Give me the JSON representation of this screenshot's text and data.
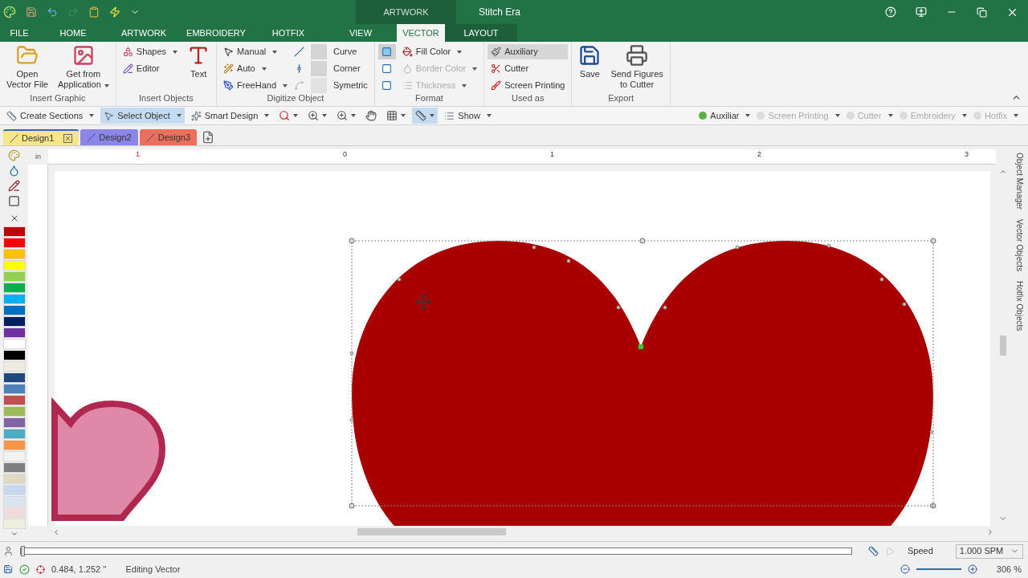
{
  "window": {
    "context_tab": "ARTWORK",
    "title": "Stitch Era"
  },
  "menu_tabs": [
    {
      "label": "FILE",
      "selected": false
    },
    {
      "label": "HOME",
      "selected": false
    },
    {
      "label": "ARTWORK",
      "selected": false
    },
    {
      "label": "EMBROIDERY",
      "selected": false
    },
    {
      "label": "HOTFIX",
      "selected": false
    },
    {
      "label": "VIEW",
      "selected": false
    },
    {
      "label": "VECTOR",
      "selected": true
    },
    {
      "label": "LAYOUT",
      "selected": false
    }
  ],
  "ribbon": [
    {
      "label": "Insert Graphic",
      "items": [
        {
          "kind": "large",
          "lines": [
            "Open",
            "Vector File"
          ],
          "dropdown": false,
          "disabled": false
        },
        {
          "kind": "large",
          "lines": [
            "Get from",
            "Application"
          ],
          "dropdown": true,
          "disabled": false
        }
      ]
    },
    {
      "label": "Insert Objects",
      "items": [
        {
          "kind": "small",
          "label": "Shapes",
          "dropdown": true,
          "disabled": false
        },
        {
          "kind": "small",
          "label": "Editor",
          "dropdown": false,
          "disabled": false
        },
        {
          "kind": "large",
          "lines": [
            "Text"
          ],
          "dropdown": false,
          "disabled": false
        }
      ]
    },
    {
      "label": "Digitize Object",
      "items": [
        {
          "kind": "small",
          "label": "Manual",
          "dropdown": true,
          "disabled": false
        },
        {
          "kind": "small",
          "label": "Auto",
          "dropdown": true,
          "disabled": false
        },
        {
          "kind": "small",
          "label": "FreeHand",
          "dropdown": true,
          "disabled": false
        },
        {
          "kind": "tool",
          "label": "Curve",
          "disabled": false
        },
        {
          "kind": "tool",
          "label": "Corner",
          "disabled": false
        },
        {
          "kind": "tool",
          "label": "Symetric",
          "disabled": true
        }
      ]
    },
    {
      "label": "Format",
      "items": [
        {
          "kind": "swatch",
          "selected": true
        },
        {
          "kind": "swatch",
          "selected": false
        },
        {
          "kind": "swatch",
          "selected": false
        },
        {
          "kind": "small",
          "label": "Fill Color",
          "dropdown": true,
          "disabled": false
        },
        {
          "kind": "small",
          "label": "Border Color",
          "dropdown": true,
          "disabled": true
        },
        {
          "kind": "small",
          "label": "Thickness",
          "dropdown": true,
          "disabled": true
        }
      ]
    },
    {
      "label": "Used as",
      "items": [
        {
          "kind": "small",
          "label": "Auxiliary",
          "dropdown": false,
          "disabled": false,
          "selected": true
        },
        {
          "kind": "small",
          "label": "Cutter",
          "dropdown": false,
          "disabled": false,
          "selected": false
        },
        {
          "kind": "small",
          "label": "Screen Printing",
          "dropdown": false,
          "disabled": false,
          "selected": false
        }
      ]
    },
    {
      "label": "Export",
      "items": [
        {
          "kind": "large",
          "lines": [
            "Save"
          ],
          "dropdown": false,
          "disabled": false
        },
        {
          "kind": "large",
          "lines": [
            "Send Figures",
            "to Cutter"
          ],
          "dropdown": false,
          "disabled": false
        }
      ]
    }
  ],
  "toolbar": [
    {
      "kind": "button",
      "label": "Create Sections",
      "selected": false
    },
    {
      "kind": "button",
      "label": "Select Object",
      "selected": true
    },
    {
      "kind": "button",
      "label": "Smart Design",
      "selected": false
    },
    {
      "kind": "icon",
      "dropdown": true,
      "selected": false
    },
    {
      "kind": "icon",
      "dropdown": true,
      "selected": false
    },
    {
      "kind": "icon",
      "dropdown": true,
      "selected": false
    },
    {
      "kind": "icon",
      "dropdown": false,
      "selected": false
    },
    {
      "kind": "icon",
      "dropdown": true,
      "selected": false
    },
    {
      "kind": "icon",
      "dropdown": true,
      "selected": true
    },
    {
      "kind": "button",
      "label": "Show",
      "selected": false
    }
  ],
  "layers": [
    {
      "label": "Auxiliar",
      "on": true
    },
    {
      "label": "Screen Printing",
      "on": false
    },
    {
      "label": "Cutter",
      "on": false
    },
    {
      "label": "Embroidery",
      "on": false
    },
    {
      "label": "Hotfix",
      "on": false
    }
  ],
  "documents": [
    {
      "label": "Design1",
      "selected": true,
      "color": "#f7e58a"
    },
    {
      "label": "Design2",
      "selected": false,
      "color": "#8c86e8"
    },
    {
      "label": "Design3",
      "selected": false,
      "color": "#e8705c"
    }
  ],
  "ruler": {
    "unit": "in",
    "marks": [
      {
        "label": "1",
        "negative": true
      },
      {
        "label": "0",
        "negative": false
      },
      {
        "label": "1",
        "negative": false
      },
      {
        "label": "2",
        "negative": false
      },
      {
        "label": "3",
        "negative": false
      }
    ]
  },
  "palette": [
    {
      "color": "#c00000"
    },
    {
      "color": "#ff0000"
    },
    {
      "color": "#ffc000"
    },
    {
      "color": "#ffff00"
    },
    {
      "color": "#92d050"
    },
    {
      "color": "#00b050"
    },
    {
      "color": "#00b0f0"
    },
    {
      "color": "#0070c0"
    },
    {
      "color": "#002060"
    },
    {
      "color": "#7030a0"
    },
    {
      "color": "#ffffff"
    },
    {
      "color": "#000000"
    },
    {
      "color": "#eeece1"
    },
    {
      "color": "#1f497d"
    },
    {
      "color": "#4f81bd"
    },
    {
      "color": "#c0504d"
    },
    {
      "color": "#9bbb59"
    },
    {
      "color": "#8064a2"
    },
    {
      "color": "#4bacc6"
    },
    {
      "color": "#f79646"
    },
    {
      "color": "#f2f2f2"
    },
    {
      "color": "#7f7f7f"
    },
    {
      "color": "#ddd9c3"
    },
    {
      "color": "#c6d9f0"
    },
    {
      "color": "#dbe5f1"
    },
    {
      "color": "#f2dcdb"
    },
    {
      "color": "#ebf1dd"
    }
  ],
  "side_panels": [
    "Object Manager",
    "Vector Objects",
    "Hotfix Objects"
  ],
  "speed": {
    "label": "Speed",
    "value": "1.000 SPM",
    "level": 0.0
  },
  "status": {
    "coords": "0.484, 1.252 ''",
    "mode": "Editing Vector",
    "zoom": "306 %"
  }
}
